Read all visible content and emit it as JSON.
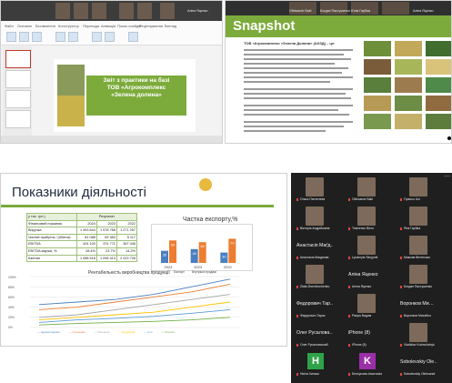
{
  "screen_a": {
    "slide_text": "Звіт з практики на базі\nТОВ «Агрокомплекс\n«Зелена долина»",
    "participant": "Аліна Яценко",
    "ribbon_tabs": [
      "Файл",
      "Основне",
      "Вставлення",
      "Конструктор",
      "Переходи",
      "Анімація",
      "Показ слайдів",
      "Рецензування",
      "Вигляд"
    ]
  },
  "screen_b": {
    "header": "Snapshot",
    "heading": "ТОВ «Агрокомплекс «Зелена Долина» (АКЗД) – це:",
    "participants": [
      "Oleksandr Bakl",
      "Богдан Пастушенко",
      "Юлія Гарбаа",
      "Аліна Яценко"
    ]
  },
  "slide_c": {
    "title": "Показники діяльності",
    "table": {
      "result_label": "Результат",
      "unit_label": "у тис. грн.)",
      "years": [
        "2024",
        "2023",
        "2022"
      ],
      "rows": [
        {
          "name": "Фінансовий показник",
          "v": [
            "2024",
            "2023",
            "2022"
          ]
        },
        {
          "name": "Виручка",
          "v": [
            "1 493 844",
            "1 578 788",
            "1 271 257"
          ]
        },
        {
          "name": "Чистий прибуток / (збиток)",
          "v": [
            "81 088",
            "69 383",
            "5 117"
          ]
        },
        {
          "name": "EBITDA",
          "v": [
            "424 100",
            "374 771",
            "367 446"
          ]
        },
        {
          "name": "EBITDA маржа, %",
          "v": [
            "28.4%",
            "23.7%",
            "14.2%"
          ]
        },
        {
          "name": "Капітал",
          "v": [
            "1 088 518",
            "1 096 413",
            "2 022 728"
          ]
        }
      ]
    },
    "bar_chart": {
      "title": "Частка експорту,%",
      "legend": [
        "Експорт",
        "Внутрішні продажі"
      ]
    },
    "line_chart": {
      "title": "Рентабельність виробництва продукції",
      "yticks": [
        "100%",
        "80%",
        "60%",
        "40%",
        "20%",
        "0%"
      ]
    }
  },
  "chart_data": [
    {
      "type": "bar",
      "title": "Частка експорту,%",
      "categories": [
        "2024",
        "2023",
        "2022"
      ],
      "series": [
        {
          "name": "Експорт",
          "values": [
            35,
            40,
            30
          ]
        },
        {
          "name": "Внутрішні продажі",
          "values": [
            65,
            60,
            70
          ]
        }
      ],
      "ylim": [
        0,
        100
      ]
    },
    {
      "type": "line",
      "title": "Рентабельність виробництва продукції",
      "categories": [
        "2019",
        "2020",
        "2021",
        "2022",
        "2023",
        "2024"
      ],
      "series": [
        {
          "name": "Цукрові буряки",
          "values": [
            45,
            50,
            55,
            65,
            80,
            95
          ]
        },
        {
          "name": "Соняшник",
          "values": [
            35,
            40,
            50,
            60,
            70,
            85
          ]
        },
        {
          "name": "Пшениця",
          "values": [
            20,
            25,
            35,
            45,
            55,
            65
          ]
        },
        {
          "name": "Кукурудза",
          "values": [
            15,
            20,
            25,
            30,
            40,
            50
          ]
        },
        {
          "name": "Соя",
          "values": [
            10,
            15,
            18,
            22,
            28,
            35
          ]
        },
        {
          "name": "Молоко",
          "values": [
            5,
            8,
            10,
            12,
            15,
            20
          ]
        }
      ],
      "ylim": [
        0,
        100
      ],
      "colors": [
        "#4a7fc1",
        "#ed7d31",
        "#a5a5a5",
        "#ffc000",
        "#5b9bd5",
        "#70ad47"
      ]
    }
  ],
  "gallery": {
    "tiles": [
      {
        "label": "Ольга Пантелеєв"
      },
      {
        "label": "Oleksandr Bakl"
      },
      {
        "label": "Гіраньо Алі"
      },
      {
        "label": "Вікторія Андрійшина"
      },
      {
        "label": "Тимченко Вікто"
      },
      {
        "label": "Яна Гарбаа"
      },
      {
        "big": "Анастасія Маґд…",
        "label": "Анастасія Магдеєва"
      },
      {
        "label": "Lyudmyla Skrypnik"
      },
      {
        "label": "Максим Вегенсько"
      },
      {
        "label": "Zlata Zhenilevchenko"
      },
      {
        "big": "Аліна Яценко",
        "label": "Аліна Яценко"
      },
      {
        "label": "Богдан Пастушенко"
      },
      {
        "big": "Федорович Тар…",
        "label": "Федорович Тарас"
      },
      {
        "label": "Ракуш Вадим"
      },
      {
        "big": "Воронков Ми…",
        "label": "Воронков Михайло"
      },
      {
        "big": "Олег Русалова…",
        "label": "Олег Русаловський"
      },
      {
        "big": "iPhone (8)",
        "label": "iPhone (8)"
      },
      {
        "label": "Vladislav Kotovshchyk"
      },
      {
        "tile": "H",
        "label": "Нікіта Хилько"
      },
      {
        "tile": "K",
        "label": "Белоусова Анастасія"
      },
      {
        "big": "Sobolevskiy Ole…",
        "label": "Sobolevskiy Oleksandr"
      }
    ]
  }
}
